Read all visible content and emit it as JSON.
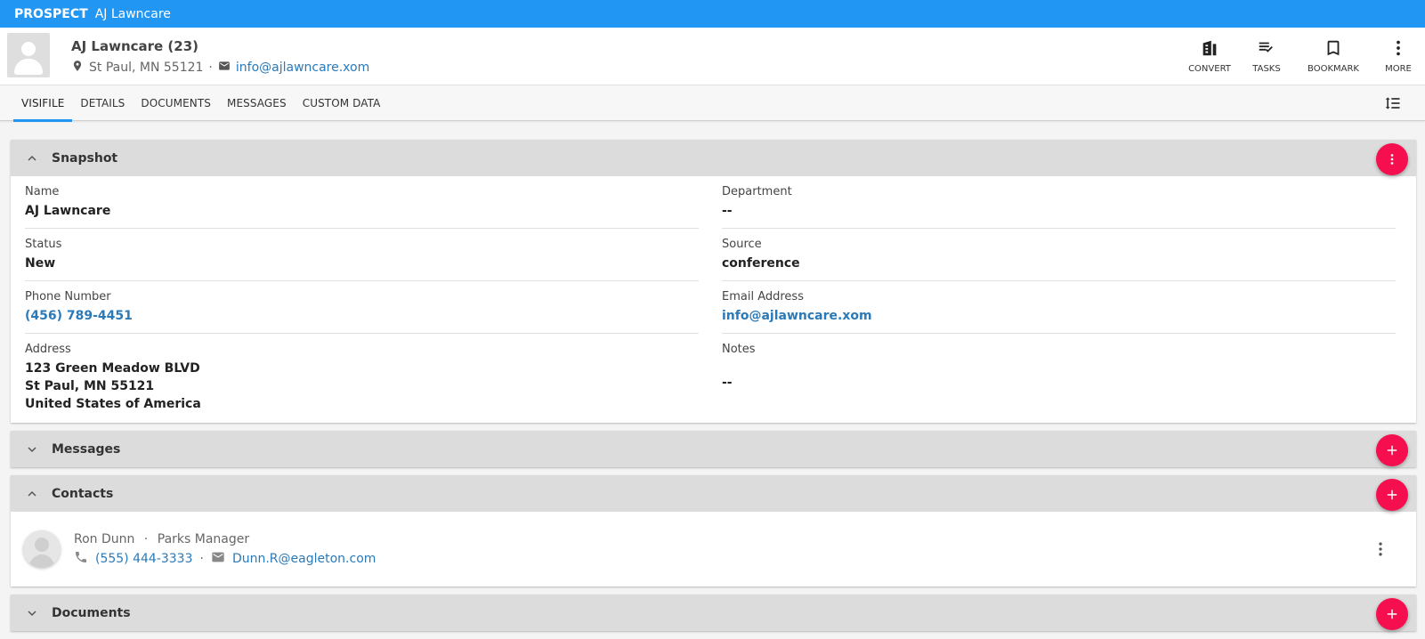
{
  "topbar": {
    "kind": "PROSPECT",
    "name": "AJ Lawncare"
  },
  "header": {
    "title": "AJ Lawncare (23)",
    "location": "St Paul, MN 55121",
    "separator": "·",
    "email": "info@ajlawncare.xom"
  },
  "actions": [
    {
      "label": "CONVERT",
      "icon": "building-icon"
    },
    {
      "label": "TASKS",
      "icon": "tasks-check-icon"
    },
    {
      "label": "BOOKMARK",
      "icon": "bookmark-icon"
    },
    {
      "label": "MORE",
      "icon": "more-vertical-icon"
    }
  ],
  "tabs": [
    "VISIFILE",
    "DETAILS",
    "DOCUMENTS",
    "MESSAGES",
    "CUSTOM DATA"
  ],
  "active_tab": "VISIFILE",
  "snapshot": {
    "title": "Snapshot",
    "name_label": "Name",
    "name_value": "AJ Lawncare",
    "department_label": "Department",
    "department_value": "--",
    "status_label": "Status",
    "status_value": "New",
    "source_label": "Source",
    "source_value": "conference",
    "phone_label": "Phone Number",
    "phone_value": "(456) 789-4451",
    "email_label": "Email Address",
    "email_value": "info@ajlawncare.xom",
    "address_label": "Address",
    "address_line1": "123 Green Meadow BLVD",
    "address_line2": "St Paul, MN 55121",
    "address_line3": "United States of America",
    "notes_label": "Notes",
    "notes_value": "--"
  },
  "messages": {
    "title": "Messages"
  },
  "contacts": {
    "title": "Contacts",
    "items": [
      {
        "name": "Ron Dunn",
        "role": "Parks Manager",
        "phone": "(555) 444-3333",
        "email": "Dunn.R@eagleton.com"
      }
    ]
  },
  "documents": {
    "title": "Documents"
  },
  "colors": {
    "primary": "#2196f3",
    "accent": "#f50f4f",
    "link": "#2a7ab9"
  }
}
